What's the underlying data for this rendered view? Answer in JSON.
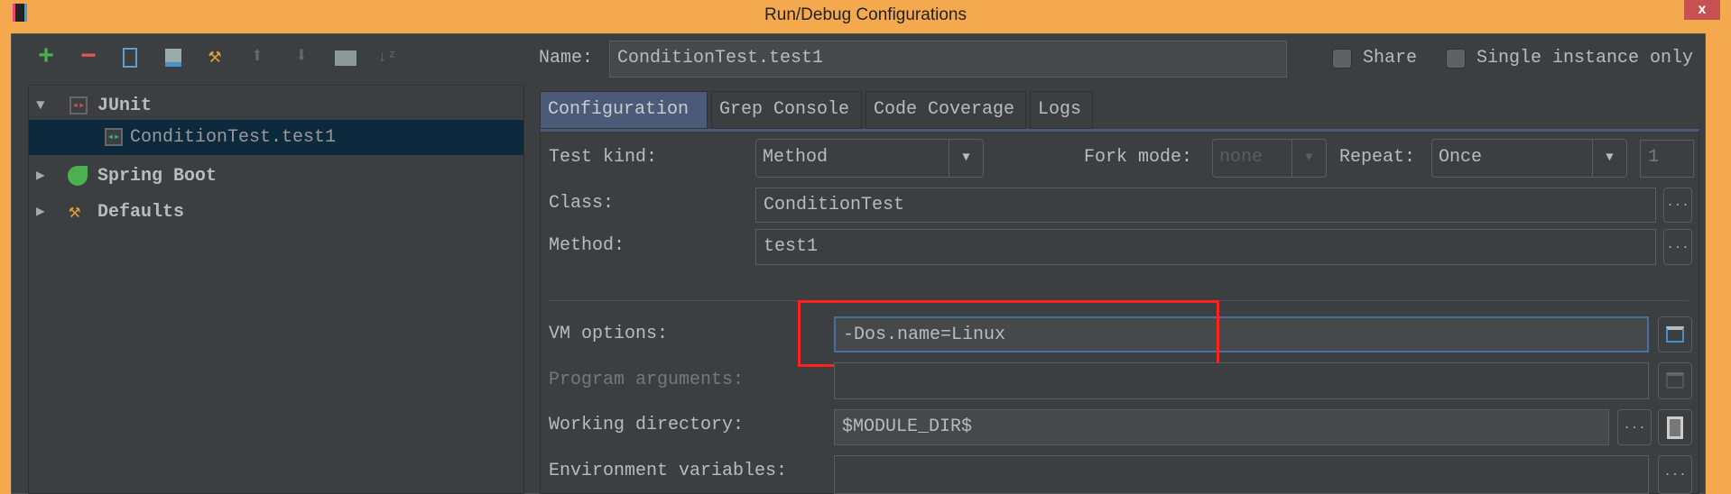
{
  "window": {
    "title": "Run/Debug Configurations",
    "close_label": "x"
  },
  "toolbar": {
    "icons": [
      "add-icon",
      "remove-icon",
      "copy-icon",
      "save-icon",
      "wrench-icon",
      "move-up-icon",
      "move-down-icon",
      "folder-icon",
      "sort-icon"
    ]
  },
  "tree": {
    "items": [
      {
        "label": "JUnit",
        "expanded": true
      },
      {
        "label": "ConditionTest.test1",
        "selected": true
      },
      {
        "label": "Spring Boot",
        "expanded": false
      },
      {
        "label": "Defaults",
        "expanded": false
      }
    ]
  },
  "header": {
    "name_label": "Name:",
    "name_value": "ConditionTest.test1",
    "share_label": "Share",
    "share_checked": false,
    "single_label": "Single instance only",
    "single_checked": false
  },
  "tabs": [
    {
      "label": "Configuration",
      "selected": true
    },
    {
      "label": "Grep Console"
    },
    {
      "label": "Code Coverage"
    },
    {
      "label": "Logs"
    }
  ],
  "form": {
    "test_kind_label": "Test kind:",
    "test_kind_value": "Method",
    "fork_mode_label": "Fork mode:",
    "fork_mode_value": "none",
    "repeat_label": "Repeat:",
    "repeat_value": "Once",
    "repeat_count": "1",
    "class_label": "Class:",
    "class_value": "ConditionTest",
    "method_label": "Method:",
    "method_value": "test1",
    "vm_label": "VM options:",
    "vm_value": "-Dos.name=Linux",
    "program_args_label": "Program arguments:",
    "program_args_value": "",
    "working_dir_label": "Working directory:",
    "working_dir_value": "$MODULE_DIR$",
    "env_label": "Environment variables:",
    "env_value": "",
    "ellipsis": "...",
    "highlight_color": "#ff2020"
  }
}
